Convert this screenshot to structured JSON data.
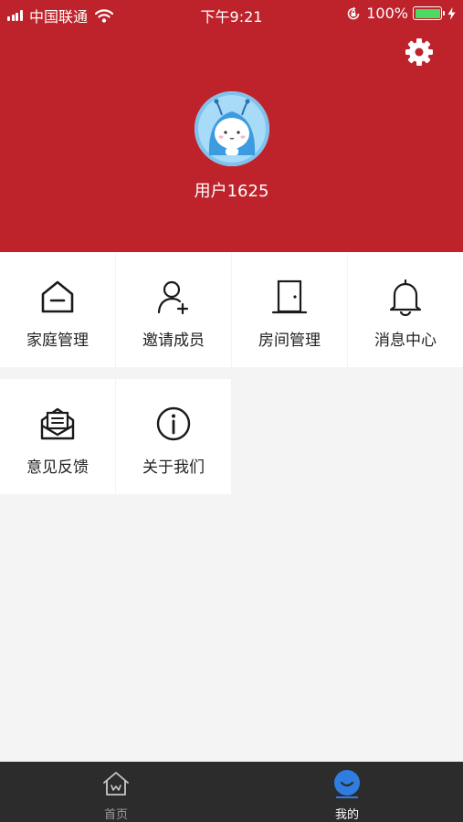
{
  "status_bar": {
    "carrier": "中国联通",
    "time": "下午9:21",
    "battery": "100%",
    "battery_level": 1.0,
    "icons": [
      "signal-icon",
      "wifi-icon",
      "rotation-lock-icon",
      "battery-icon",
      "charging-icon"
    ]
  },
  "header": {
    "background_color": "#be232c",
    "username": "用户1625",
    "settings_icon": "gear-icon",
    "avatar": "cartoon-avatar"
  },
  "menu": {
    "items": [
      {
        "label": "家庭管理",
        "icon": "home-icon"
      },
      {
        "label": "邀请成员",
        "icon": "add-user-icon"
      },
      {
        "label": "房间管理",
        "icon": "door-icon"
      },
      {
        "label": "消息中心",
        "icon": "bell-icon"
      },
      {
        "label": "意见反馈",
        "icon": "mail-icon"
      },
      {
        "label": "关于我们",
        "icon": "info-icon"
      }
    ]
  },
  "tabbar": {
    "tabs": [
      {
        "label": "首页",
        "icon": "home-tab-icon",
        "active": false
      },
      {
        "label": "我的",
        "icon": "profile-tab-icon",
        "active": true
      }
    ],
    "active_color": "#2f7de1",
    "inactive_color": "#9a9a9a"
  }
}
